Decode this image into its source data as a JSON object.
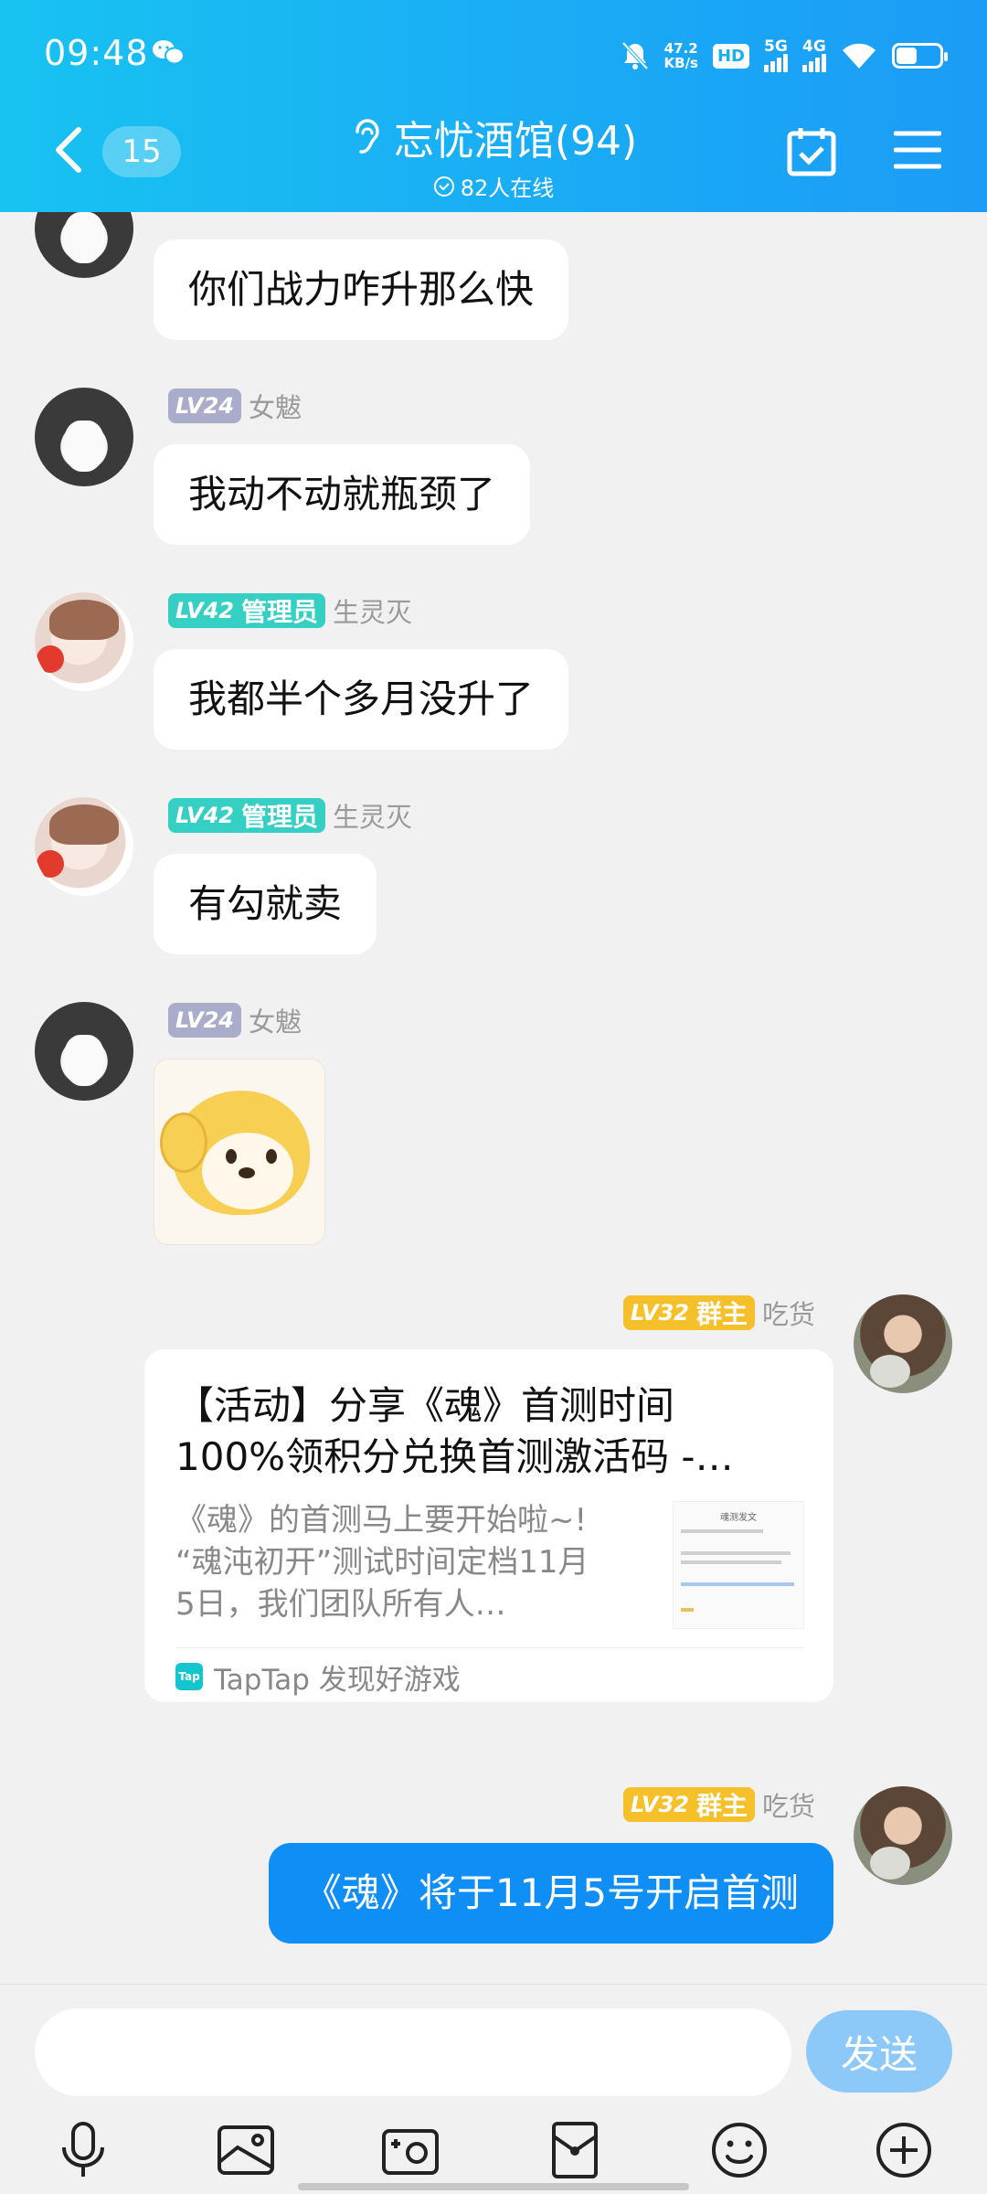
{
  "status_bar": {
    "time": "09:48",
    "net_speed_value": "47.2",
    "net_speed_unit": "KB/s",
    "hd": "HD",
    "sig1_label": "5G",
    "sig2_label": "4G",
    "icons": [
      "wechat-icon",
      "mute-bell-icon",
      "wifi-icon",
      "battery-icon"
    ]
  },
  "header": {
    "unread_count": "15",
    "group_name": "忘忧酒馆(94)",
    "online_text": "82人在线",
    "icons": [
      "back-icon",
      "ear-icon",
      "check-circle-icon",
      "calendar-check-icon",
      "menu-icon"
    ]
  },
  "messages": [
    {
      "name": "",
      "text": "你们战力咋升那么快"
    },
    {
      "level": "LV24",
      "role": "",
      "name": "女魃",
      "text": "我动不动就瓶颈了"
    },
    {
      "level": "LV42",
      "role": "管理员",
      "name": "生灵灭",
      "text": "我都半个多月没升了"
    },
    {
      "level": "LV42",
      "role": "管理员",
      "name": "生灵灭",
      "text": "有勾就卖"
    },
    {
      "level": "LV24",
      "role": "",
      "name": "女魃",
      "sticker": "doge-salute-sticker"
    },
    {
      "level": "LV32",
      "role": "群主",
      "name": "吃货",
      "card": {
        "title_line1": "【活动】分享《魂》首测时间",
        "title_line2": "100%领积分兑换首测激活码 -…",
        "desc_line1": "《魂》的首测马上要开始啦~!",
        "desc_line2": "“魂沌初开”测试时间定档11月",
        "desc_line3": "5日，我们团队所有人…",
        "thumb_title": "魂测发文",
        "source": "TapTap 发现好游戏",
        "source_logo": "Tap"
      }
    },
    {
      "level": "LV32",
      "role": "群主",
      "name": "吃货",
      "text": "《魂》将于11月5号开启首测"
    }
  ],
  "input_bar": {
    "placeholder": "",
    "send_label": "发送",
    "tools": [
      "voice-icon",
      "image-icon",
      "camera-icon",
      "red-packet-icon",
      "emoji-icon",
      "plus-icon"
    ]
  },
  "colors": {
    "header_start": "#18c3f1",
    "header_end": "#1b9cf6",
    "bubble_self": "#0f8ef6",
    "send_button": "#8dc9f8",
    "lv_gray": "#a9adc9",
    "lv_teal": "#35d0c3",
    "lv_gold": "#f6c02a"
  }
}
